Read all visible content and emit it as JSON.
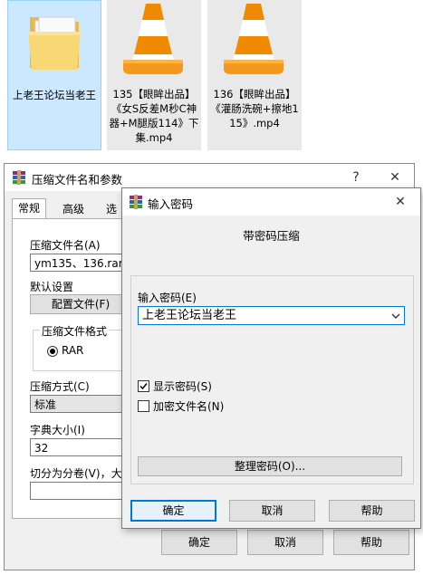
{
  "files": [
    {
      "label": "上老王论坛当老王",
      "icon": "folder-icon"
    },
    {
      "label": "135【眼眸出品】《女S反差M秒C神器+M腿版114》下集.mp4",
      "icon": "vlc-cone-icon"
    },
    {
      "label": "136【眼眸出品】《灌肠洗碗+擦地115》.mp4",
      "icon": "vlc-cone-icon"
    }
  ],
  "main_dialog": {
    "title": "压缩文件名和参数",
    "help_glyph": "?",
    "close_glyph": "✕",
    "tabs": [
      "常规",
      "高级",
      "选项"
    ],
    "archive_name_label": "压缩文件名(A)",
    "archive_name_value": "ym135、136.rar",
    "default_settings_label": "默认设置",
    "profiles_button": "配置文件(F)",
    "format_group_label": "压缩文件格式",
    "format_option": "RAR",
    "method_label": "压缩方式(C)",
    "method_value": "标准",
    "dict_label": "字典大小(I)",
    "dict_value": "32",
    "split_label": "切分为分卷(V)，大小",
    "ok": "确定",
    "cancel": "取消",
    "help": "帮助"
  },
  "password_dialog": {
    "title": "输入密码",
    "close_glyph": "✕",
    "heading": "带密码压缩",
    "password_label": "输入密码(E)",
    "password_value": "上老王论坛当老王",
    "show_password": "显示密码(S)",
    "show_password_checked": true,
    "encrypt_names": "加密文件名(N)",
    "encrypt_names_checked": false,
    "organize_button": "整理密码(O)...",
    "ok": "确定",
    "cancel": "取消",
    "help": "帮助"
  },
  "colors": {
    "selection": "#cce8ff",
    "accent": "#0078d7",
    "vlc_orange": "#f08a00"
  }
}
